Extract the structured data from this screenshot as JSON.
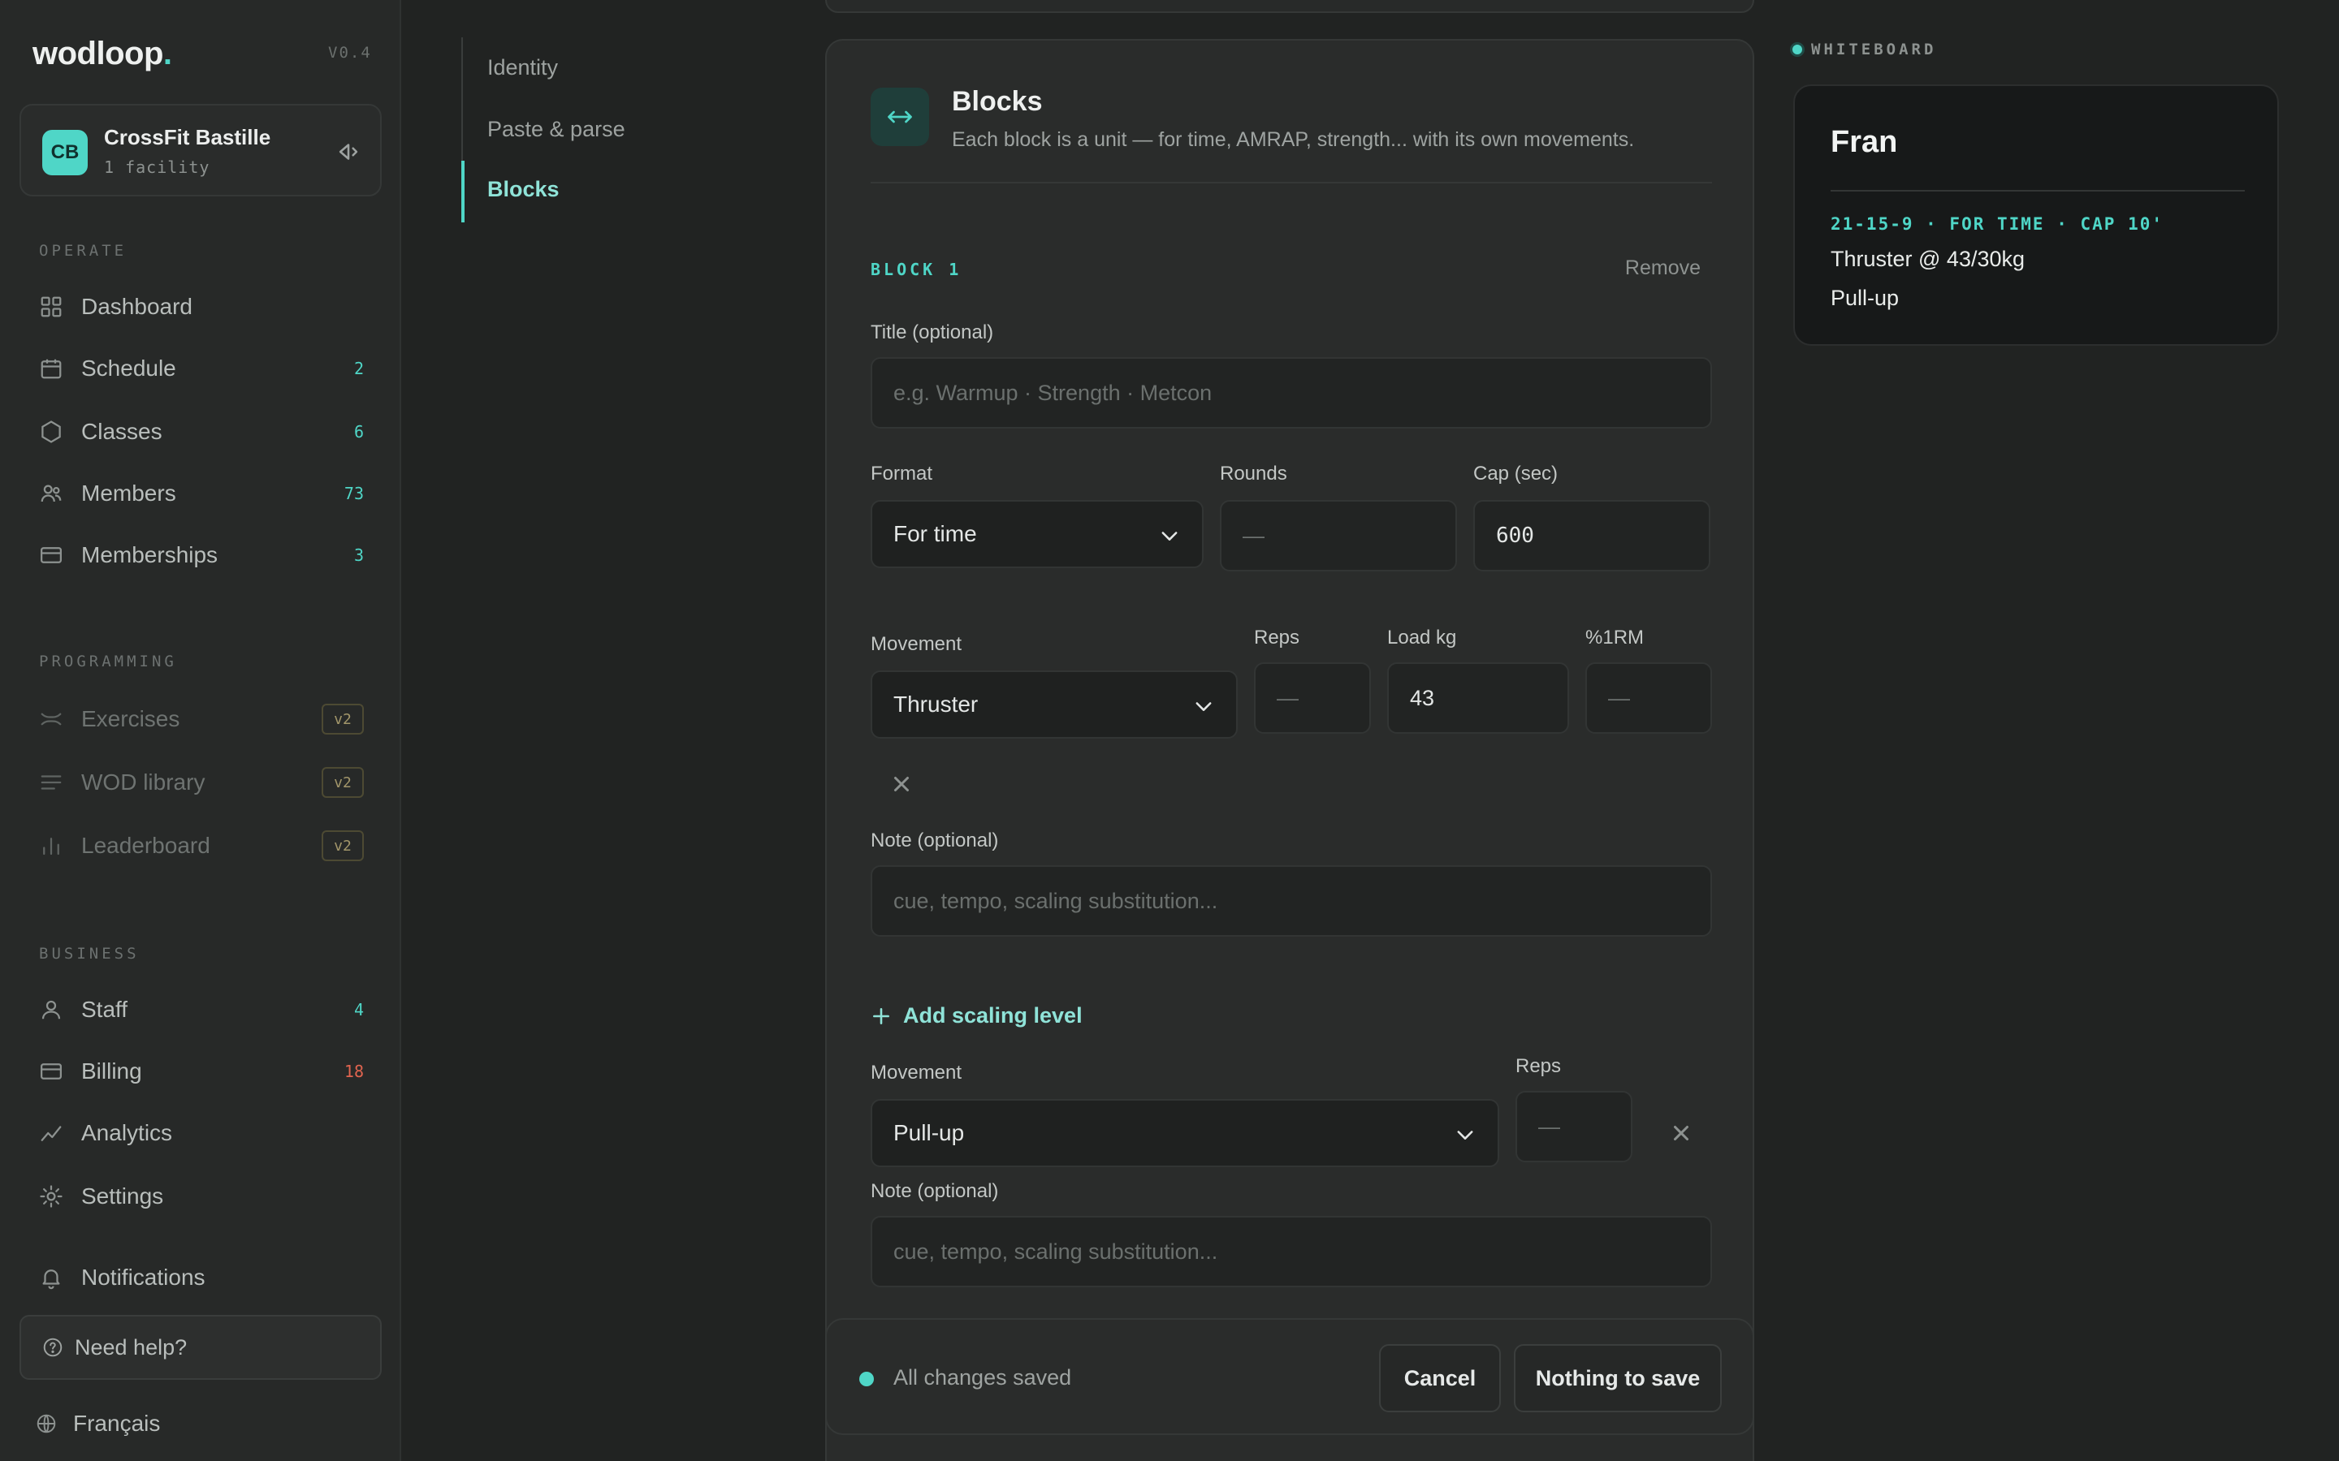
{
  "app": {
    "brand": "wodloop",
    "brand_dot": ".",
    "version": "V0.4",
    "accent_color": "#4fd6c7"
  },
  "facility": {
    "initials": "CB",
    "name": "CrossFit Bastille",
    "subtitle": "1 facility",
    "switch_icon": "panel-switch-icon"
  },
  "sidebar": {
    "sections": {
      "operate": "OPERATE",
      "programming": "PROGRAMMING",
      "business": "BUSINESS"
    },
    "operate": [
      {
        "label": "Dashboard",
        "icon": "grid-icon",
        "count": ""
      },
      {
        "label": "Schedule",
        "icon": "calendar-icon",
        "count": "2"
      },
      {
        "label": "Classes",
        "icon": "hexagon-icon",
        "count": "6"
      },
      {
        "label": "Members",
        "icon": "users-icon",
        "count": "73"
      },
      {
        "label": "Memberships",
        "icon": "card-icon",
        "count": "3"
      }
    ],
    "programming": [
      {
        "label": "Exercises",
        "icon": "dumbbell-icon",
        "badge": "v2"
      },
      {
        "label": "WOD library",
        "icon": "list-icon",
        "badge": "v2"
      },
      {
        "label": "Leaderboard",
        "icon": "bar-chart-icon",
        "badge": "v2"
      }
    ],
    "business": [
      {
        "label": "Staff",
        "icon": "user-icon",
        "count": "4"
      },
      {
        "label": "Billing",
        "icon": "billing-icon",
        "count": "18"
      },
      {
        "label": "Analytics",
        "icon": "trend-icon",
        "count": ""
      },
      {
        "label": "Settings",
        "icon": "gear-icon",
        "count": ""
      }
    ],
    "notifications": "Notifications",
    "help": "Need help?",
    "language": "Français"
  },
  "section_nav": {
    "items": [
      "Identity",
      "Paste & parse",
      "Blocks"
    ],
    "active": "Blocks"
  },
  "blocks_card": {
    "title": "Blocks",
    "description": "Each block is a unit — for time, AMRAP, strength... with its own movements.",
    "block_label": "BLOCK 1",
    "remove": "Remove",
    "title_field": {
      "label": "Title (optional)",
      "placeholder": "e.g. Warmup · Strength · Metcon"
    },
    "format": {
      "label": "Format",
      "value": "For time"
    },
    "rounds": {
      "label": "Rounds",
      "placeholder": "—"
    },
    "cap": {
      "label": "Cap (sec)",
      "value": "600"
    },
    "movement1": {
      "label": "Movement",
      "value": "Thruster",
      "reps_label": "Reps",
      "reps_placeholder": "—",
      "load_label": "Load kg",
      "load_value": "43",
      "rm_label": "%1RM",
      "rm_placeholder": "—",
      "note_label": "Note (optional)",
      "note_placeholder": "cue, tempo, scaling substitution..."
    },
    "add_scaling": "Add scaling level",
    "movement2": {
      "label": "Movement",
      "value": "Pull-up",
      "reps_label": "Reps",
      "reps_placeholder": "—",
      "note_label": "Note (optional)",
      "note_placeholder": "cue, tempo, scaling substitution..."
    }
  },
  "savebar": {
    "status": "All changes saved",
    "cancel": "Cancel",
    "save": "Nothing to save"
  },
  "whiteboard": {
    "label": "WHITEBOARD",
    "title": "Fran",
    "meta": "21-15-9 · FOR TIME · CAP 10'",
    "lines": [
      "Thruster @ 43/30kg",
      "Pull-up"
    ]
  }
}
